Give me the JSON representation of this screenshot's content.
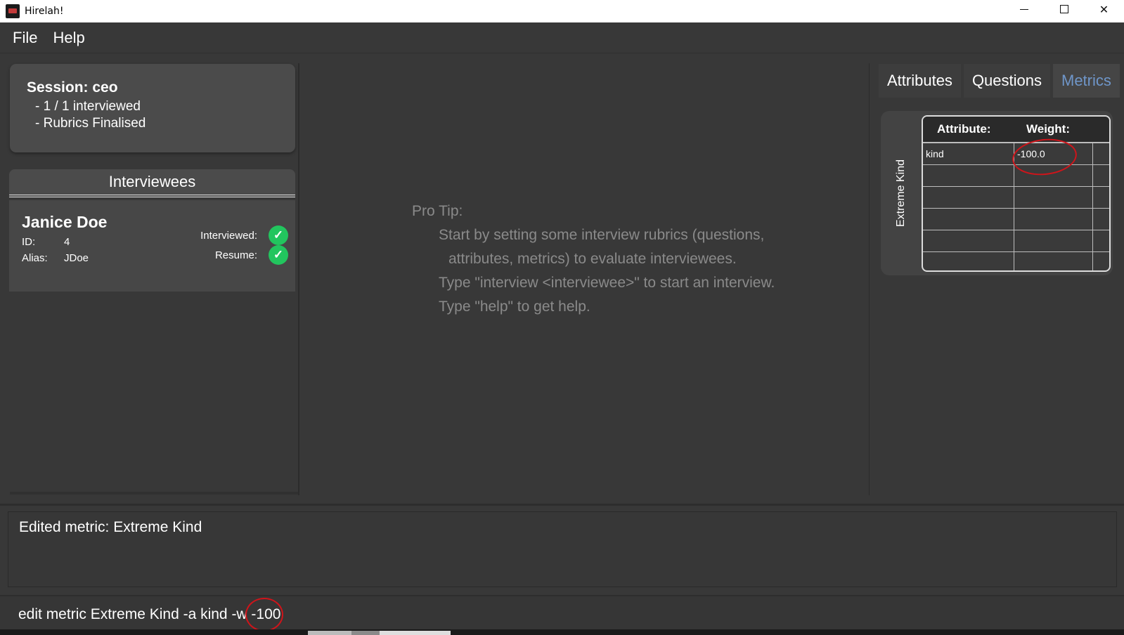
{
  "window": {
    "title": "Hirelah!"
  },
  "menu": {
    "file": "File",
    "help": "Help"
  },
  "session": {
    "title": "Session: ceo",
    "interviewed": "- 1 / 1 interviewed",
    "rubrics": "- Rubrics Finalised"
  },
  "interviewees": {
    "header": "Interviewees",
    "items": [
      {
        "name": "Janice Doe",
        "id_label": "ID:",
        "id": "4",
        "alias_label": "Alias:",
        "alias": "JDoe",
        "interviewed_label": "Interviewed:",
        "resume_label": "Resume:",
        "interviewed": true,
        "resume": true
      }
    ]
  },
  "tip": {
    "heading": "Pro Tip:",
    "line1": "Start by setting some interview rubrics (questions,",
    "line2": "attributes, metrics) to evaluate interviewees.",
    "line3": "Type \"interview <interviewee>\" to start an interview.",
    "line4": "Type \"help\" to get help."
  },
  "tabs": [
    {
      "label": "Attributes",
      "active": false
    },
    {
      "label": "Questions",
      "active": false
    },
    {
      "label": "Metrics",
      "active": true
    }
  ],
  "metric": {
    "name": "Extreme Kind",
    "col_attribute": "Attribute:",
    "col_weight": "Weight:",
    "rows": [
      {
        "attribute": "kind",
        "weight": "-100.0"
      }
    ]
  },
  "result": {
    "text": "Edited metric: Extreme Kind"
  },
  "command": {
    "value": "edit metric Extreme Kind -a kind -w -100"
  },
  "colors": {
    "background": "#383838",
    "active_tab": "#6f96c9",
    "check": "#22c55e",
    "annotation": "#d0141a"
  }
}
